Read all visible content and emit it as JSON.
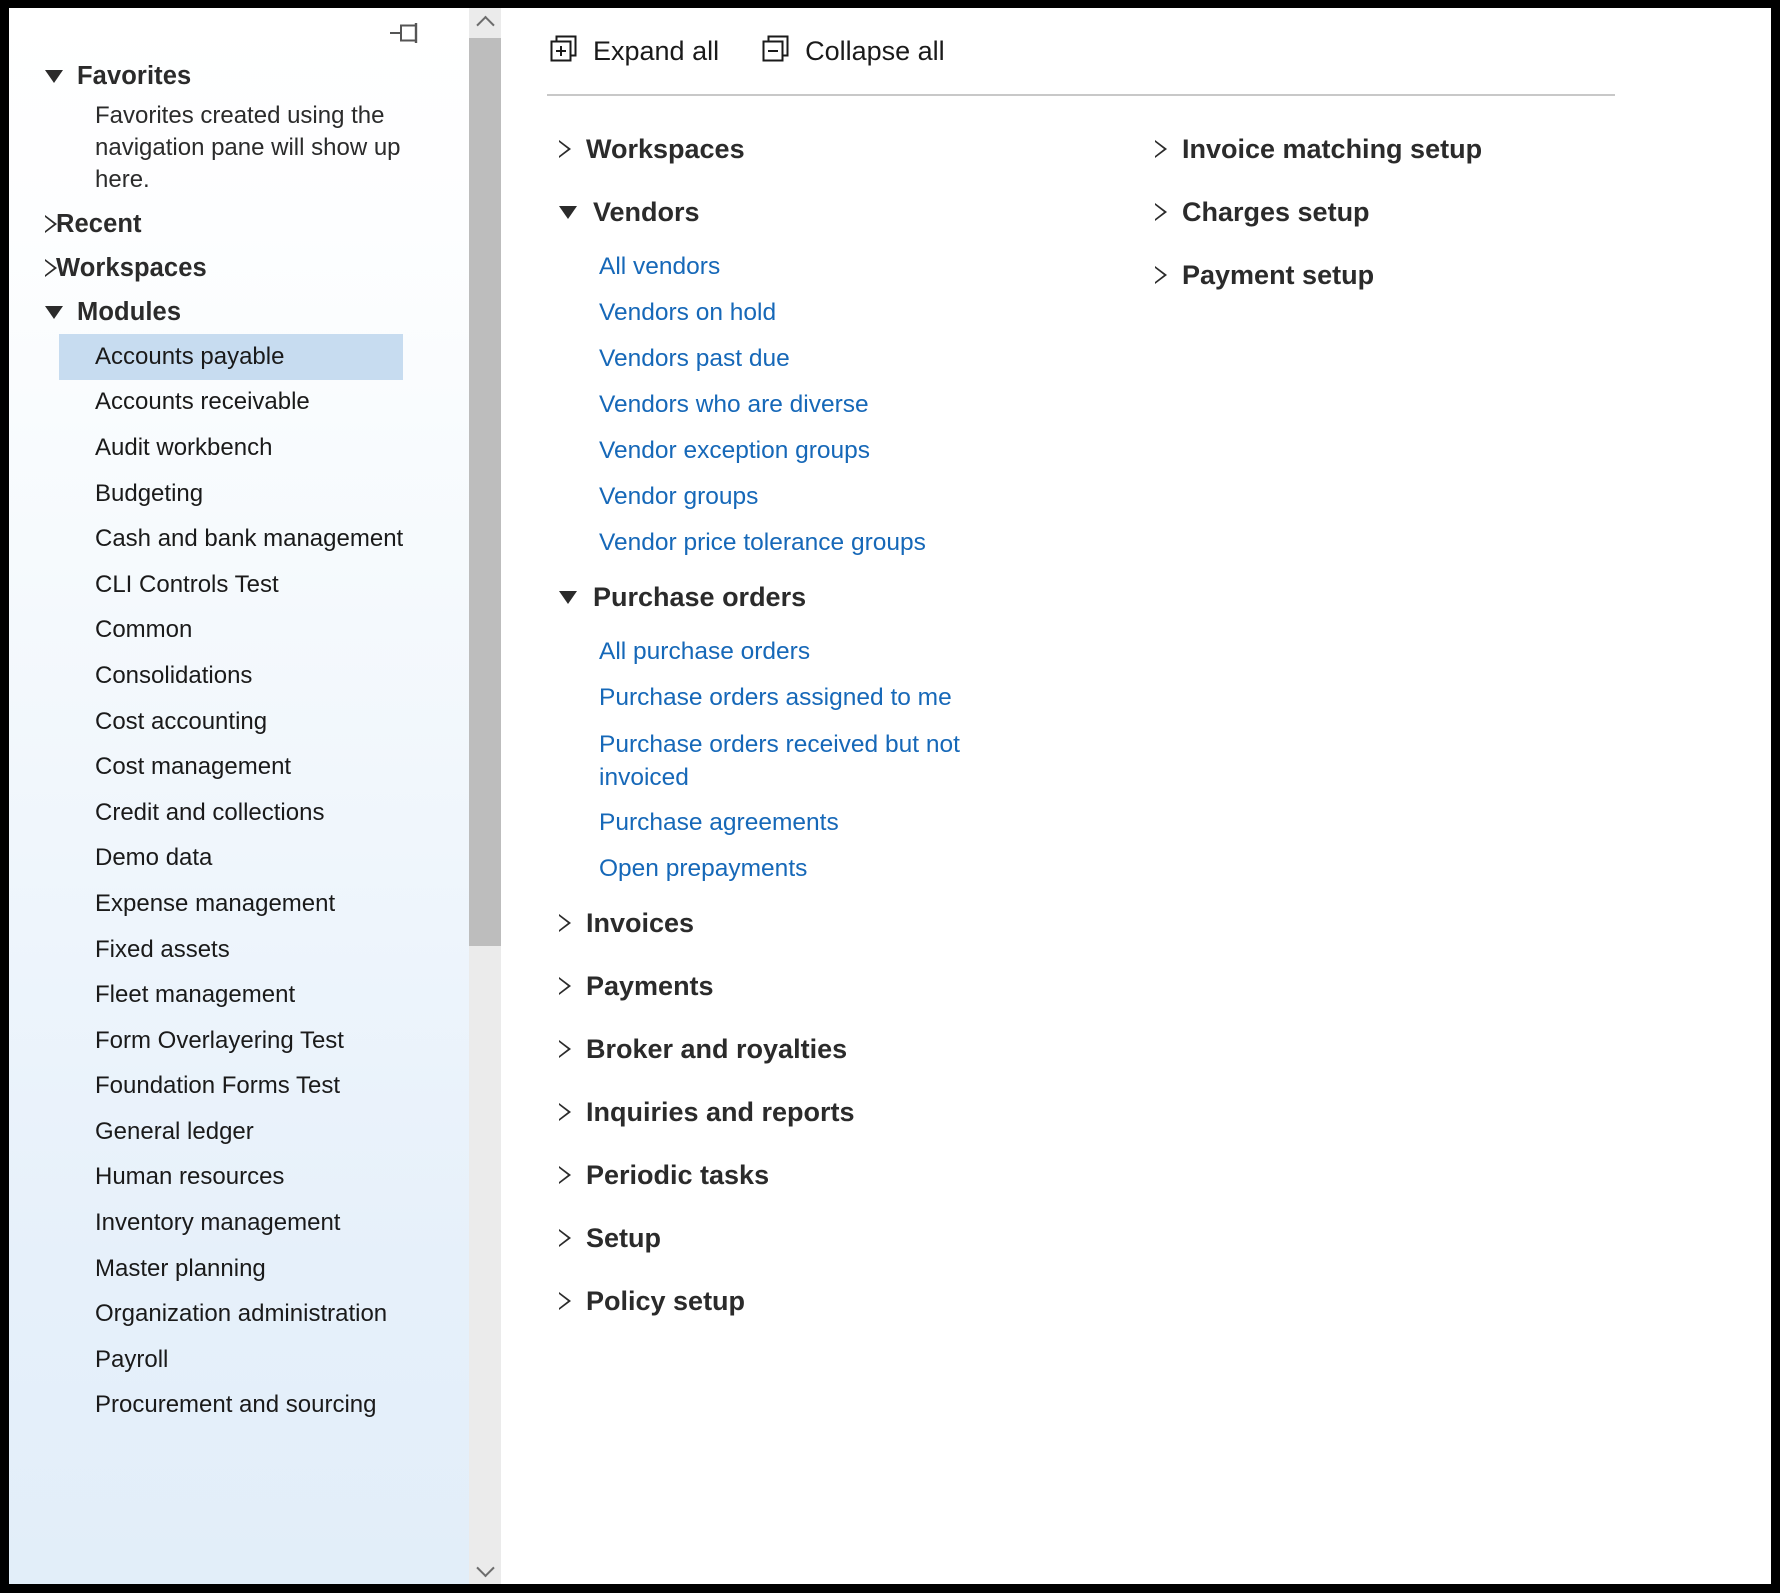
{
  "nav_pane": {
    "pin_icon": "pin-icon",
    "groups": [
      {
        "label": "Favorites",
        "state": "expanded"
      },
      {
        "label": "Recent",
        "state": "collapsed"
      },
      {
        "label": "Workspaces",
        "state": "collapsed"
      },
      {
        "label": "Modules",
        "state": "expanded"
      }
    ],
    "favorites_note": "Favorites created using the navigation pane will show up here.",
    "modules": [
      "Accounts payable",
      "Accounts receivable",
      "Audit workbench",
      "Budgeting",
      "Cash and bank management",
      "CLI Controls Test",
      "Common",
      "Consolidations",
      "Cost accounting",
      "Cost management",
      "Credit and collections",
      "Demo data",
      "Expense management",
      "Fixed assets",
      "Fleet management",
      "Form Overlayering Test",
      "Foundation Forms Test",
      "General ledger",
      "Human resources",
      "Inventory management",
      "Master planning",
      "Organization administration",
      "Payroll",
      "Procurement and sourcing"
    ],
    "selected_module": "Accounts payable",
    "scrollbar": {
      "up_arrow_icon": "chevron-up-icon",
      "down_arrow_icon": "chevron-down-icon"
    }
  },
  "toolbar": {
    "expand_all_label": "Expand all",
    "expand_all_icon": "expand-all-icon",
    "collapse_all_label": "Collapse all",
    "collapse_all_icon": "collapse-all-icon"
  },
  "tree": {
    "left_column": [
      {
        "type": "head",
        "label": "Workspaces",
        "state": "collapsed"
      },
      {
        "type": "head",
        "label": "Vendors",
        "state": "expanded"
      },
      {
        "type": "link",
        "label": "All vendors"
      },
      {
        "type": "link",
        "label": "Vendors on hold"
      },
      {
        "type": "link",
        "label": "Vendors past due"
      },
      {
        "type": "link",
        "label": "Vendors who are diverse"
      },
      {
        "type": "link",
        "label": "Vendor exception groups"
      },
      {
        "type": "link",
        "label": "Vendor groups"
      },
      {
        "type": "link",
        "label": "Vendor price tolerance groups"
      },
      {
        "type": "head",
        "label": "Purchase orders",
        "state": "expanded"
      },
      {
        "type": "link",
        "label": "All purchase orders"
      },
      {
        "type": "link",
        "label": "Purchase orders assigned to me"
      },
      {
        "type": "link",
        "label": "Purchase orders received but not invoiced",
        "wrap": true
      },
      {
        "type": "link",
        "label": "Purchase agreements"
      },
      {
        "type": "link",
        "label": "Open prepayments"
      },
      {
        "type": "head",
        "label": "Invoices",
        "state": "collapsed"
      },
      {
        "type": "head",
        "label": "Payments",
        "state": "collapsed"
      },
      {
        "type": "head",
        "label": "Broker and royalties",
        "state": "collapsed"
      },
      {
        "type": "head",
        "label": "Inquiries and reports",
        "state": "collapsed"
      },
      {
        "type": "head",
        "label": "Periodic tasks",
        "state": "collapsed"
      },
      {
        "type": "head",
        "label": "Setup",
        "state": "collapsed"
      },
      {
        "type": "head",
        "label": "Policy setup",
        "state": "collapsed"
      }
    ],
    "right_column": [
      {
        "type": "head",
        "label": "Invoice matching setup",
        "state": "collapsed"
      },
      {
        "type": "head",
        "label": "Charges setup",
        "state": "collapsed"
      },
      {
        "type": "head",
        "label": "Payment setup",
        "state": "collapsed"
      }
    ]
  },
  "colors": {
    "link_blue": "#1668b8",
    "selected_row": "#c7dcf0",
    "heading_text": "#2b2b2b",
    "divider": "#c8c8c8",
    "scrollbar_thumb": "#bdbdbd",
    "scrollbar_track": "#ebebeb"
  }
}
